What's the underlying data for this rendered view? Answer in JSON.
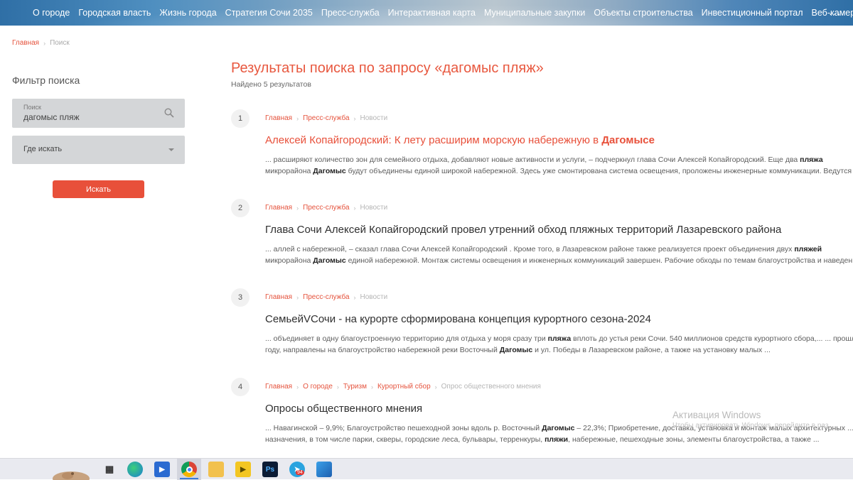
{
  "topnav": {
    "items": [
      "О городе",
      "Городская власть",
      "Жизнь города",
      "Стратегия Сочи 2035",
      "Пресс-служба",
      "Интерактивная карта",
      "Муниципальные закупки",
      "Объекты строительства",
      "Инвестиционный портал",
      "Веб-камеры"
    ],
    "more": "..."
  },
  "breadcrumb": {
    "home": "Главная",
    "current": "Поиск"
  },
  "sidebar": {
    "title": "Фильтр поиска",
    "search_label": "Поиск",
    "search_value": "дагомыс пляж",
    "where_label": "Где искать",
    "submit": "Искать"
  },
  "results": {
    "title": "Результаты поиска по запросу «дагомыс пляж»",
    "count": "Найдено 5 результатов",
    "items": [
      {
        "num": "1",
        "crumbs": [
          "Главная",
          "Пресс-служба"
        ],
        "crumb_current": "Новости",
        "title_pre": "Алексей Копайгородский: К лету расширим морскую набережную в ",
        "title_bold": "Дагомысе",
        "snippet": [
          [
            "... расширяют количество зон для семейного отдыха, добавляют новые активности и услуги, – подчеркнул глава Сочи Алексей Копайгородский. Еще два ",
            "пляжа"
          ],
          [
            "микрорайона ",
            "Дагомыс",
            " будут объединены единой широкой набережной. Здесь уже смонтирована система освещения, проложены инженерные коммуникации. Ведутся"
          ]
        ]
      },
      {
        "num": "2",
        "crumbs": [
          "Главная",
          "Пресс-служба"
        ],
        "crumb_current": "Новости",
        "title": "Глава Сочи Алексей Копайгородский провел утренний обход пляжных территорий Лазаревского района",
        "snippet": [
          [
            "... аллей с набережной, – сказал глава Сочи Алексей Копайгородский . Кроме того, в Лазаревском районе также реализуется проект объединения двух ",
            "пляжей"
          ],
          [
            "микрорайона ",
            "Дагомыс",
            " единой набережной. Монтаж системы освещения и инженерных коммуникаций завершен. Рабочие обходы по темам благоустройства и наведен"
          ]
        ]
      },
      {
        "num": "3",
        "crumbs": [
          "Главная",
          "Пресс-служба"
        ],
        "crumb_current": "Новости",
        "title": "СемьейVСочи - на курорте сформирована концепция курортного сезона-2024",
        "snippet": [
          [
            "... объединяет в одну благоустроенную территорию для отдыха у моря сразу три ",
            "пляжа",
            " вплоть до устья реки Сочи. 540 миллионов средств курортного сбора,... ... прошл"
          ],
          [
            "году, направлены на благоустройство набережной реки Восточный ",
            "Дагомыс",
            " и ул. Победы в Лазаревском районе, а также на установку малых ..."
          ]
        ]
      },
      {
        "num": "4",
        "crumbs": [
          "Главная",
          "О городе",
          "Туризм",
          "Курортный сбор"
        ],
        "crumb_current": "Опрос общественного мнения",
        "title": "Опросы общественного мнения",
        "snippet": [
          [
            "... Навагинской – 9,9%; Благоустройство пешеходной зоны вдоль р. Восточный ",
            "Дагомыс",
            " – 22,3%; Приобретение, доставка, установка и монтаж малых архитектурных ..."
          ],
          [
            "назначения, в том числе парки, скверы, городские леса, бульвары, терренкуры, ",
            "пляжи",
            ", набережные, пешеходные зоны, элементы благоустройства, а также ..."
          ]
        ]
      }
    ]
  },
  "watermark": {
    "title": "Активация Windows",
    "subtitle": "Чтобы активировать Windows, перейдите в раз"
  },
  "taskbar": {
    "icons": [
      "task-view-icon",
      "edge-icon",
      "media-player-icon",
      "chrome-icon",
      "file-explorer-icon",
      "video-icon",
      "photoshop-icon",
      "telegram-icon",
      "paint-icon"
    ],
    "telegram_badge": "94",
    "photoshop_label": "Ps"
  },
  "colors": {
    "accent": "#e8503a",
    "link": "#e5533d",
    "panel": "#d4d6d8"
  }
}
